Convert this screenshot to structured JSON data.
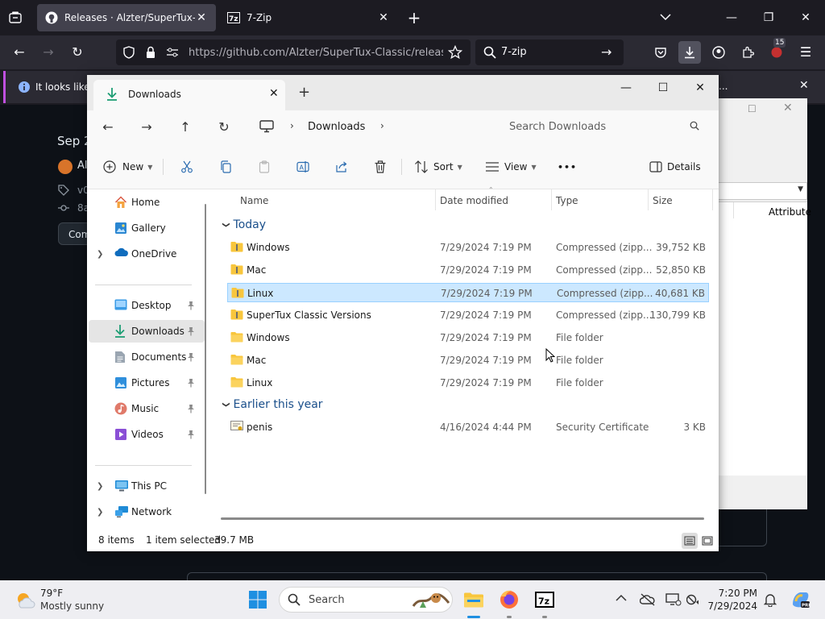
{
  "browser": {
    "tabs": [
      {
        "title": "Releases · Alzter/SuperTux-Classic",
        "active": true
      },
      {
        "title": "7-Zip",
        "active": false
      }
    ],
    "url": "https://github.com/Alzter/SuperTux-Classic/releases",
    "search_text": "7-zip",
    "extensions_badge": "15",
    "notification": "It looks like"
  },
  "page": {
    "date_fragment": "Sep 2",
    "author_fragment": "Al",
    "tag_fragment": "v0",
    "commit_fragment": "8a",
    "compare_fragment": "Com"
  },
  "background_window": {
    "column_attr": "Attribute"
  },
  "explorer": {
    "tab_title": "Downloads",
    "breadcrumb": "Downloads",
    "search_placeholder": "Search Downloads",
    "toolbar": {
      "new": "New",
      "sort": "Sort",
      "view": "View",
      "more": "•••",
      "details": "Details"
    },
    "sidebar": {
      "home": "Home",
      "gallery": "Gallery",
      "onedrive": "OneDrive",
      "desktop": "Desktop",
      "downloads": "Downloads",
      "documents": "Documents",
      "pictures": "Pictures",
      "music": "Music",
      "videos": "Videos",
      "thispc": "This PC",
      "network": "Network"
    },
    "columns": {
      "name": "Name",
      "date": "Date modified",
      "type": "Type",
      "size": "Size"
    },
    "groups": {
      "today": "Today",
      "earlier": "Earlier this year"
    },
    "rows": [
      {
        "name": "Windows",
        "date": "7/29/2024 7:19 PM",
        "type": "Compressed (zipp...",
        "size": "39,752 KB"
      },
      {
        "name": "Mac",
        "date": "7/29/2024 7:19 PM",
        "type": "Compressed (zipp...",
        "size": "52,850 KB"
      },
      {
        "name": "Linux",
        "date": "7/29/2024 7:19 PM",
        "type": "Compressed (zipp...",
        "size": "40,681 KB"
      },
      {
        "name": "SuperTux Classic Versions",
        "date": "7/29/2024 7:19 PM",
        "type": "Compressed (zipp...",
        "size": "130,799 KB"
      },
      {
        "name": "Windows",
        "date": "7/29/2024 7:19 PM",
        "type": "File folder",
        "size": ""
      },
      {
        "name": "Mac",
        "date": "7/29/2024 7:19 PM",
        "type": "File folder",
        "size": ""
      },
      {
        "name": "Linux",
        "date": "7/29/2024 7:19 PM",
        "type": "File folder",
        "size": ""
      },
      {
        "name": "penis",
        "date": "4/16/2024 4:44 PM",
        "type": "Security Certificate",
        "size": "3 KB"
      }
    ],
    "status": {
      "items": "8 items",
      "selected": "1 item selected",
      "size": "39.7 MB"
    }
  },
  "taskbar": {
    "temperature": "79°F",
    "condition": "Mostly sunny",
    "search": "Search",
    "time": "7:20 PM",
    "date": "7/29/2024"
  },
  "colors": {
    "accent": "#0078d4",
    "selection": "#cce8ff",
    "folder": "#f8c63d",
    "browser_dark": "#1c1b22"
  }
}
